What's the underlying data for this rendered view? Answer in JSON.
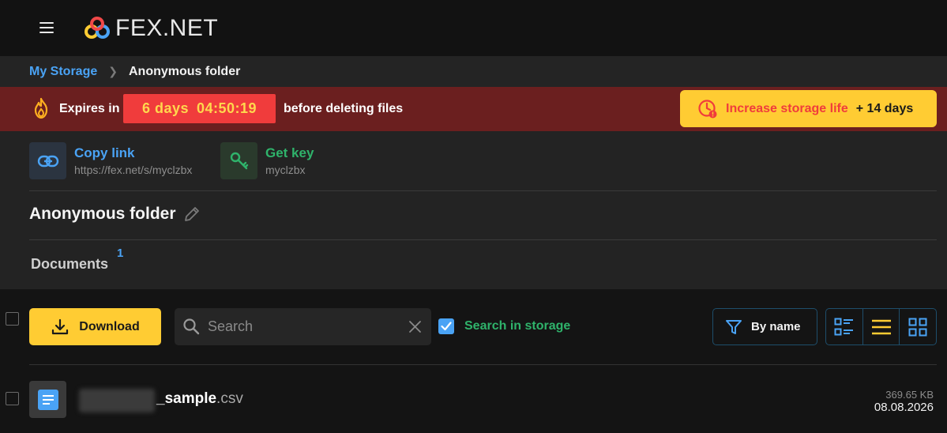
{
  "header": {
    "logo_text": "FEX.NET"
  },
  "breadcrumb": {
    "root": "My Storage",
    "current": "Anonymous folder"
  },
  "expiry": {
    "prefix": "Expires in",
    "days": "6 days",
    "time": "04:50:19",
    "suffix": "before deleting files",
    "increase_label": "Increase storage life",
    "increase_days": "+ 14 days"
  },
  "share": {
    "copy_title": "Copy link",
    "copy_url": "https://fex.net/s/myclzbx",
    "key_title": "Get key",
    "key_value": "myclzbx"
  },
  "folder": {
    "title": "Anonymous folder",
    "tab_label": "Documents",
    "tab_count": "1"
  },
  "toolbar": {
    "download_label": "Download",
    "search_placeholder": "Search",
    "search_in_storage": "Search in storage",
    "search_in_storage_checked": true,
    "sort_label": "By name"
  },
  "files": [
    {
      "name": "_sample",
      "ext": ".csv",
      "size": "369.65 KB",
      "date": "08.08.2026"
    }
  ],
  "colors": {
    "accent_blue": "#4aa3f5",
    "accent_yellow": "#ffcc33",
    "danger_red": "#f03c3c",
    "success_green": "#2fb36b",
    "expiry_bg": "#6b1f1f"
  }
}
